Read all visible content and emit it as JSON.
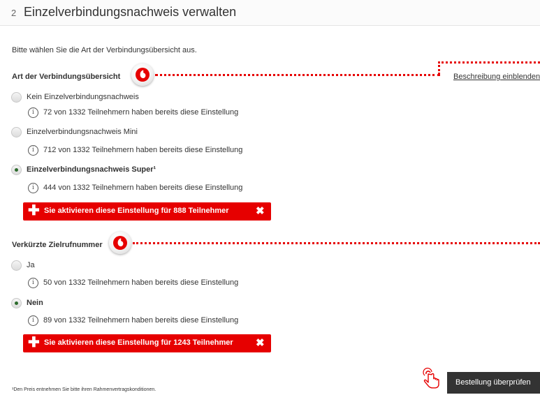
{
  "header": {
    "step": "2",
    "title": "Einzelverbindungsnachweis verwalten"
  },
  "intro": "Bitte wählen Sie die Art der Verbindungsübersicht aus.",
  "description_link": "Beschreibung einblenden",
  "sections": [
    {
      "title": "Art der Verbindungsübersicht",
      "logo_icon": "vodafone-logo-icon",
      "options": [
        {
          "label": "Kein Einzelverbindungsnachweis",
          "selected": false,
          "info": "72 von 1332 Teilnehmern haben bereits diese Einstellung"
        },
        {
          "label": "Einzelverbindungsnachweis Mini",
          "selected": false,
          "info": "712 von 1332 Teilnehmern haben bereits diese Einstellung"
        },
        {
          "label": "Einzelverbindungsnachweis Super¹",
          "selected": true,
          "info": "444 von 1332 Teilnehmern haben bereits diese Einstellung"
        }
      ],
      "action": {
        "label": "Sie aktivieren diese Einstellung für 888 Teilnehmer",
        "plus_icon": "plus-icon",
        "close_icon": "close-icon"
      }
    },
    {
      "title": "Verkürzte Zielrufnummer",
      "logo_icon": "vodafone-logo-icon",
      "options": [
        {
          "label": "Ja",
          "selected": false,
          "info": "50 von 1332 Teilnehmern haben bereits diese Einstellung"
        },
        {
          "label": "Nein",
          "selected": true,
          "info": "89 von 1332 Teilnehmern haben bereits diese Einstellung"
        }
      ],
      "action": {
        "label": "Sie aktivieren diese Einstellung für 1243 Teilnehmer",
        "plus_icon": "plus-icon",
        "close_icon": "close-icon"
      }
    }
  ],
  "footnote": "¹Den Preis entnehmen Sie bitte ihren Rahmenvertragskonditionen.",
  "review_button": "Bestellung überprüfen",
  "colors": {
    "accent": "#e60000",
    "radio_selected": "#2b6b2b",
    "button_dark": "#333333"
  }
}
